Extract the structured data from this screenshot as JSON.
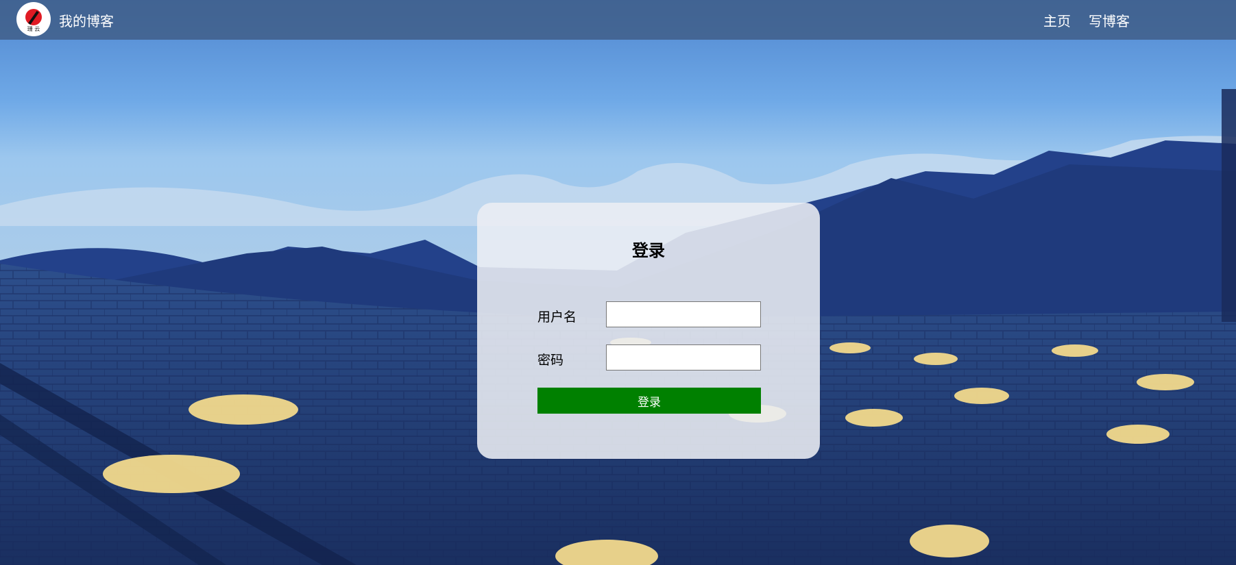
{
  "navbar": {
    "logo_text": "珊 云",
    "site_title": "我的博客",
    "links": [
      {
        "label": "主页"
      },
      {
        "label": "写博客"
      }
    ]
  },
  "login": {
    "title": "登录",
    "username_label": "用户名",
    "username_value": "",
    "password_label": "密码",
    "password_value": "",
    "submit_label": "登录"
  },
  "colors": {
    "navbar_bg": "#3e5a82",
    "button_bg": "#008000",
    "button_text": "#ffffff",
    "card_bg": "#eceef4"
  }
}
